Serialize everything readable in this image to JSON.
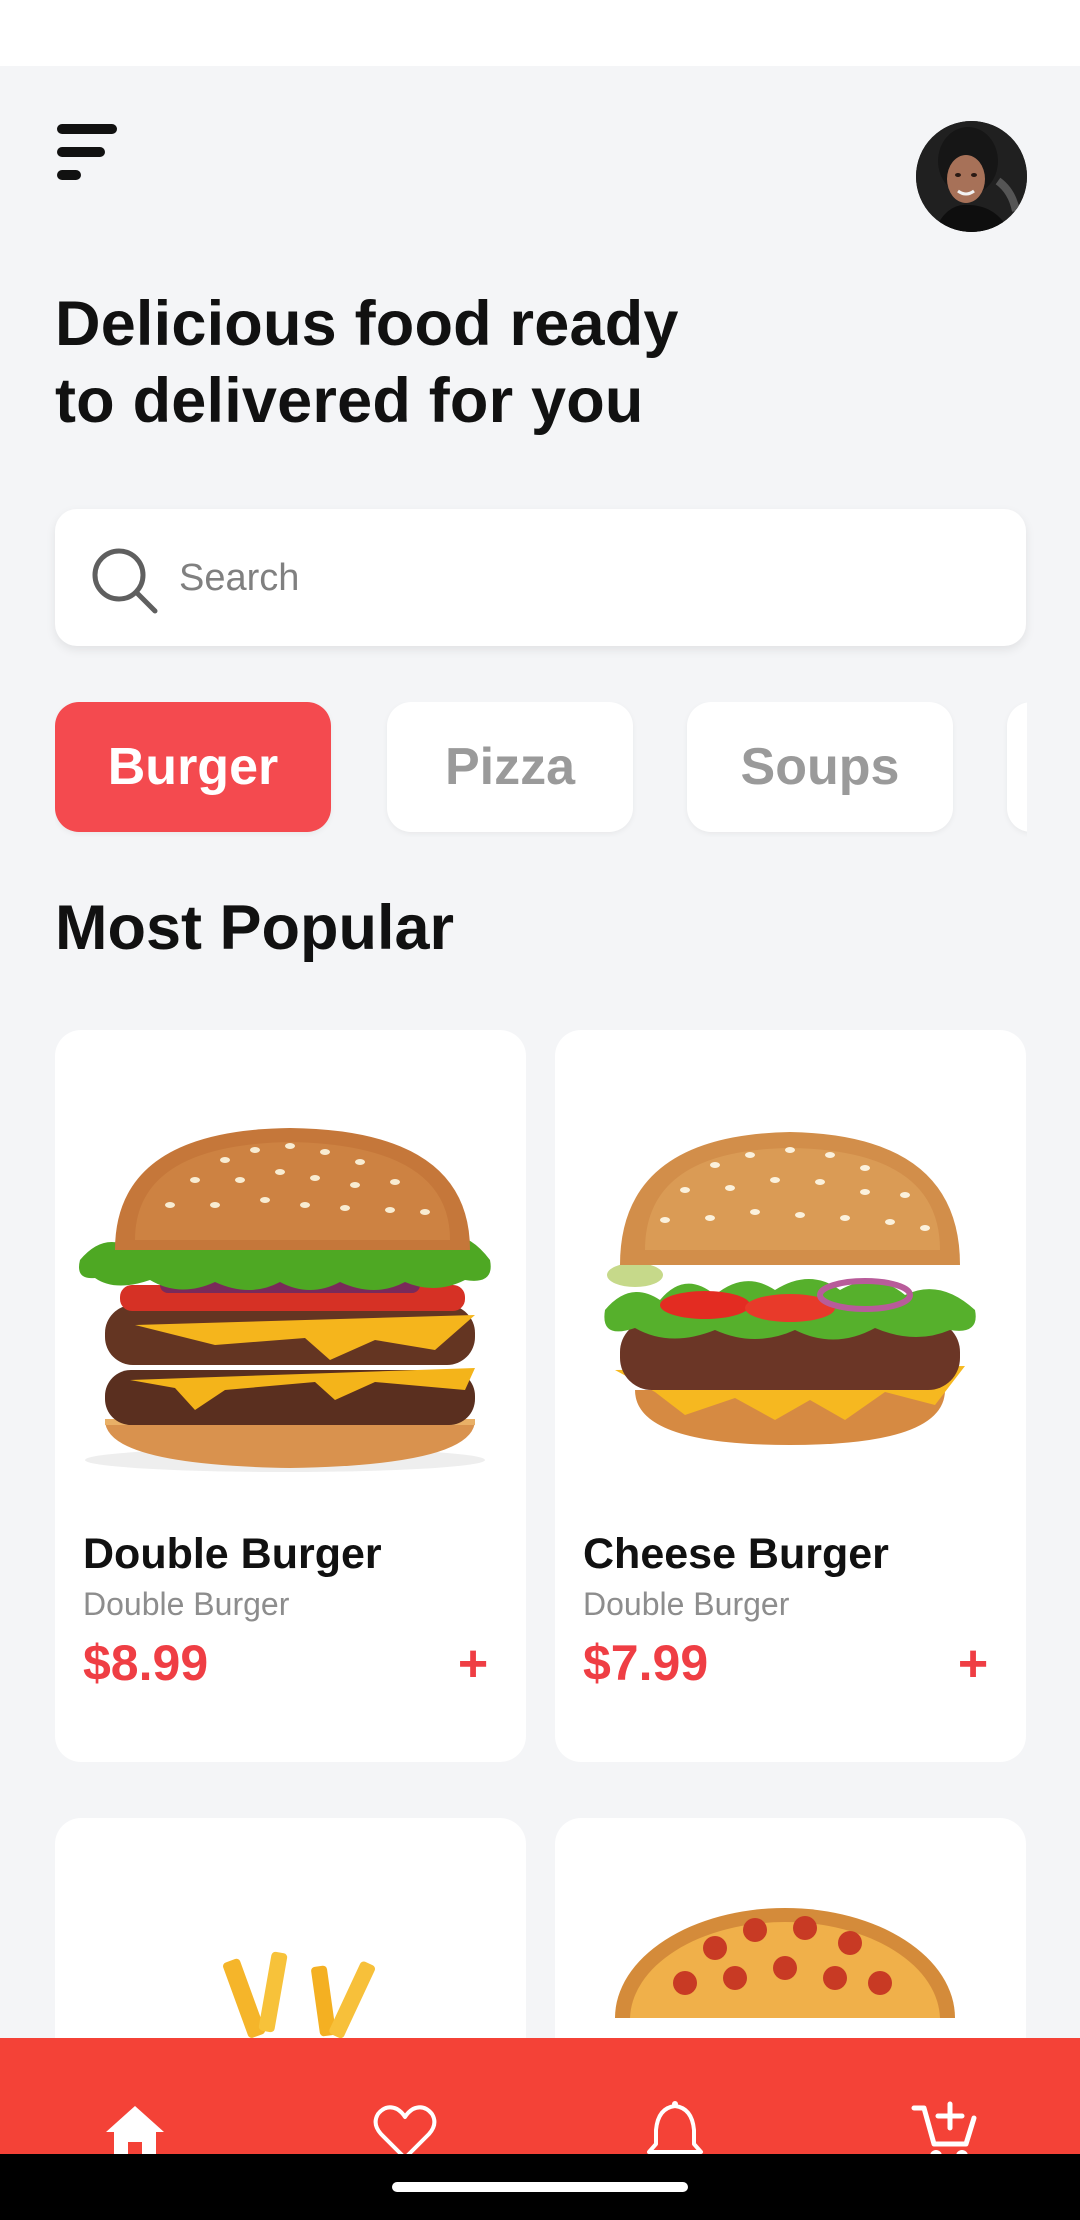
{
  "header": {
    "headline_line1": "Delicious food ready",
    "headline_line2": "to delivered for you"
  },
  "search": {
    "placeholder": "Search"
  },
  "categories": [
    {
      "label": "Burger",
      "active": true
    },
    {
      "label": "Pizza",
      "active": false
    },
    {
      "label": "Soups",
      "active": false
    }
  ],
  "section": {
    "title": "Most Popular"
  },
  "products": [
    {
      "name": "Double Burger",
      "subtitle": "Double Burger",
      "price": "$8.99",
      "add": "+"
    },
    {
      "name": "Cheese Burger",
      "subtitle": "Double Burger",
      "price": "$7.99",
      "add": "+"
    }
  ],
  "bottom_nav": [
    "home-icon",
    "heart-icon",
    "bell-icon",
    "cart-add-icon"
  ],
  "colors": {
    "accent": "#f44237",
    "price": "#ef3e44",
    "background": "#f4f5f7"
  }
}
